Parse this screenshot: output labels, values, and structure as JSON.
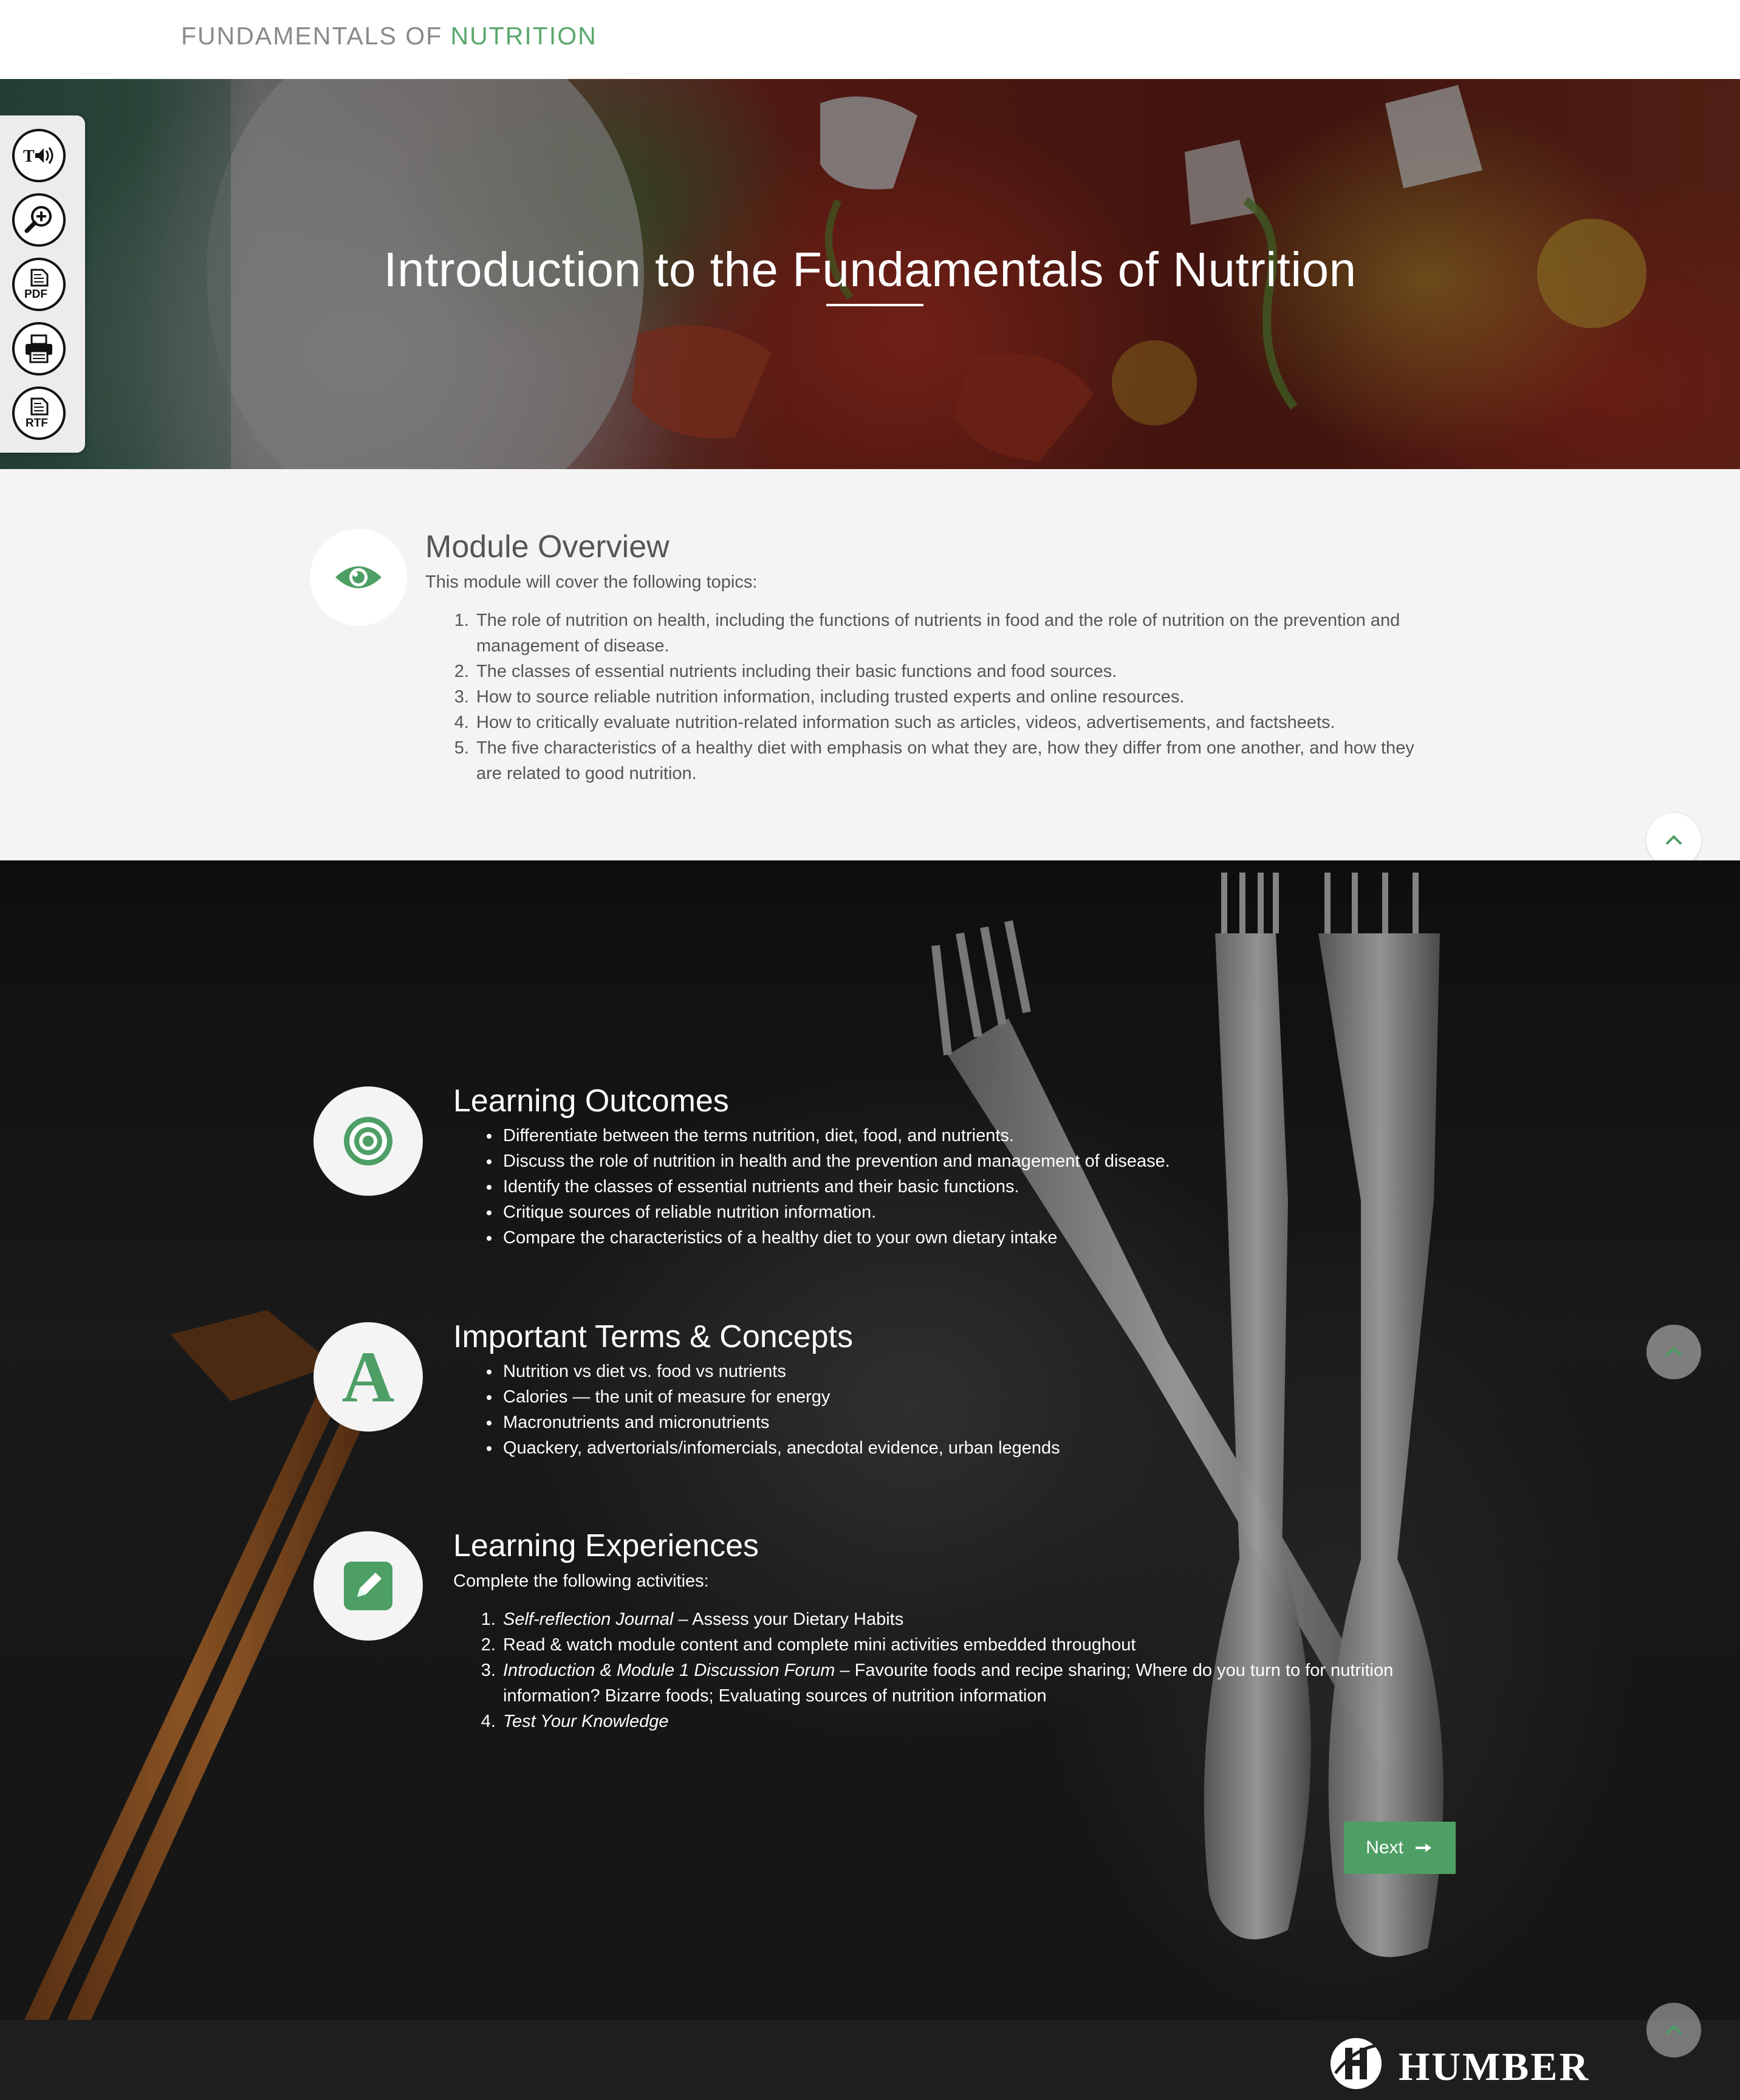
{
  "header": {
    "brand_prefix": "FUNDAMENTALS OF ",
    "brand_accent": "NUTRITION"
  },
  "hero": {
    "title": "Introduction to the Fundamentals of Nutrition",
    "background": "salad photo (tomatoes, arugula, feta) darkened"
  },
  "toolbar": {
    "buttons": [
      {
        "icon": "text-to-speech-icon",
        "label": "T"
      },
      {
        "icon": "zoom-in-icon"
      },
      {
        "icon": "pdf-icon",
        "label": "PDF"
      },
      {
        "icon": "printer-icon"
      },
      {
        "icon": "rtf-icon",
        "label": "RTF"
      }
    ]
  },
  "overview": {
    "title": "Module Overview",
    "intro": "This module will cover the following topics:",
    "icon": "eye-icon",
    "items": [
      "The role of nutrition on health, including the functions of nutrients in food and the role of nutrition on the prevention and management of disease.",
      "The classes of essential nutrients including their basic functions and food sources.",
      "How to source reliable nutrition information, including trusted experts and online resources.",
      "How to critically evaluate nutrition-related information such as articles, videos, advertisements, and factsheets.",
      "The five characteristics of a healthy diet with emphasis on what they are, how they differ from one another, and how they are related to good nutrition."
    ]
  },
  "outcomes": {
    "title": "Learning Outcomes",
    "icon": "target-icon",
    "items": [
      "Differentiate between the terms nutrition, diet, food, and nutrients.",
      "Discuss the role of nutrition in health and the prevention and management of disease.",
      "Identify the classes of essential nutrients and their basic functions.",
      "Critique sources of reliable nutrition information.",
      "Compare the characteristics of a healthy diet to your own dietary intake"
    ]
  },
  "terms": {
    "title": "Important Terms & Concepts",
    "icon_letter": "A",
    "items": [
      "Nutrition vs diet vs. food vs nutrients",
      "Calories — the unit of measure for energy",
      "Macronutrients and micronutrients",
      "Quackery, advertorials/infomercials, anecdotal evidence, urban legends"
    ]
  },
  "experiences": {
    "title": "Learning Experiences",
    "icon": "pencil-icon",
    "intro": "Complete the following activities:",
    "items": [
      {
        "em": "Self-reflection Journal",
        "rest": " – Assess your Dietary Habits"
      },
      {
        "em": "",
        "rest": "Read & watch module content and complete mini activities embedded throughout"
      },
      {
        "em": "Introduction & Module 1 Discussion Forum",
        "rest": " – Favourite foods and recipe sharing; Where do you turn to for nutrition information? Bizarre foods; Evaluating sources of nutrition information"
      },
      {
        "em": "Test Your Knowledge",
        "rest": ""
      }
    ]
  },
  "next_button": {
    "label": "Next"
  },
  "footer": {
    "logo_text": "HUMBER"
  },
  "colors": {
    "accent": "#5aa86e",
    "button_green": "#4e9f65",
    "light_bg": "#f4f4f4",
    "footer_bg": "#1e1e1e"
  }
}
